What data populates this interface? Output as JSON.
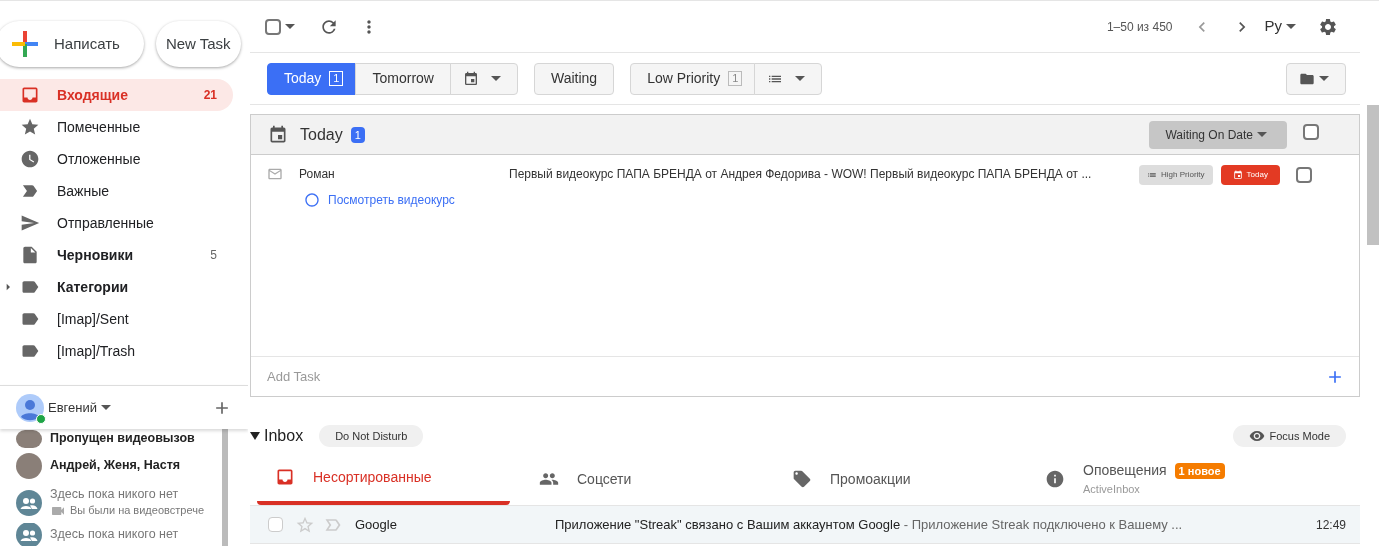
{
  "compose": {
    "label": "Написать"
  },
  "new_task": {
    "label": "New Task"
  },
  "sidebar": {
    "items": [
      {
        "label": "Входящие",
        "count": "21",
        "kind": "inbox",
        "selected": true,
        "bold": true
      },
      {
        "label": "Помеченные",
        "kind": "star",
        "selected": false,
        "bold": false
      },
      {
        "label": "Отложенные",
        "kind": "clock",
        "selected": false,
        "bold": false
      },
      {
        "label": "Важные",
        "kind": "important",
        "selected": false,
        "bold": false
      },
      {
        "label": "Отправленные",
        "kind": "send",
        "selected": false,
        "bold": false
      },
      {
        "label": "Черновики",
        "count": "5",
        "kind": "draft",
        "selected": false,
        "bold": true
      },
      {
        "label": "Категории",
        "kind": "label",
        "selected": false,
        "bold": true,
        "expanded": false
      },
      {
        "label": "[Imap]/Sent",
        "kind": "label",
        "selected": false,
        "bold": false
      },
      {
        "label": "[Imap]/Trash",
        "kind": "label",
        "selected": false,
        "bold": false
      }
    ]
  },
  "chat": {
    "user": {
      "name": "Евгений",
      "online": true
    },
    "conversations": [
      {
        "kind": "photo",
        "name": "Пропущен видеовызов",
        "bold": true
      },
      {
        "kind": "photo",
        "name": "Андрей, Женя, Настя",
        "bold": true
      },
      {
        "kind": "group",
        "name": "Здесь пока никого нет",
        "subtitle": "Вы были на видеовстрече",
        "bold": false
      },
      {
        "kind": "group",
        "name": "Здесь пока никого нет",
        "bold": false
      }
    ]
  },
  "toolbar": {
    "checked": false,
    "page_info": "1–50 из 450",
    "language": "Ру"
  },
  "filter_groups": [
    {
      "items": [
        {
          "kind": "tab",
          "label": "Today",
          "count": "1",
          "selected": true
        },
        {
          "kind": "tab",
          "label": "Tomorrow",
          "selected": false
        },
        {
          "kind": "calendar",
          "selected": false
        }
      ]
    },
    {
      "items": [
        {
          "kind": "tab",
          "label": "Waiting",
          "selected": false
        }
      ]
    },
    {
      "items": [
        {
          "kind": "tab",
          "label": "Low Priority",
          "count": "1",
          "selected": false
        },
        {
          "kind": "list",
          "selected": false
        }
      ]
    }
  ],
  "today_panel": {
    "title": "Today",
    "count": "1",
    "sort": "Waiting On Date",
    "checked": false,
    "tasks": [
      {
        "sender": "Роман",
        "subject": "Первый видеокурс ПАПА БРЕНДА от Андрея Федорива - WOW! Первый видеокурс ПАПА БРЕНДА от ...",
        "action": "Посмотреть видеокурс",
        "checked": false,
        "tags": [
          {
            "kind": "priority",
            "label": "High Priority"
          },
          {
            "kind": "date",
            "label": "Today"
          }
        ]
      }
    ],
    "add_task": {
      "placeholder": "Add Task"
    }
  },
  "inbox": {
    "title": "Inbox",
    "expanded": true,
    "dnd": "Do Not Disturb",
    "focus": "Focus Mode",
    "tabs": [
      {
        "kind": "inbox",
        "label": "Несортированные",
        "selected": true
      },
      {
        "kind": "people",
        "label": "Соцсети",
        "selected": false
      },
      {
        "kind": "tag",
        "label": "Промоакции",
        "selected": false
      },
      {
        "kind": "info",
        "label": "Оповещения",
        "badge": "1 новое",
        "sub": "ActiveInbox",
        "selected": false
      }
    ],
    "messages": [
      {
        "sender": "Google",
        "subject": "Приложение \"Streak\" связано с Вашим аккаунтом Google",
        "snippet": " - Приложение Streak подключено к Вашему ...",
        "time": "12:49",
        "checked": false,
        "starred": false
      }
    ]
  }
}
